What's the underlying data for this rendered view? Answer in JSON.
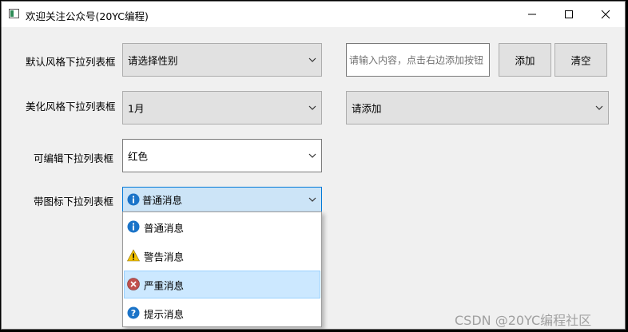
{
  "window": {
    "title": "欢迎关注公众号(20YC编程)"
  },
  "row1": {
    "label": "默认风格下拉列表框",
    "combo_value": "请选择性别",
    "input_placeholder": "请输入内容，点击右边添加按钮",
    "add_button": "添加",
    "clear_button": "清空"
  },
  "row2": {
    "label": "美化风格下拉列表框",
    "combo_value": "1月",
    "combo2_value": "请添加"
  },
  "row3": {
    "label": "可编辑下拉列表框",
    "combo_value": "红色"
  },
  "row4": {
    "label": "带图标下拉列表框",
    "combo_value": "普通消息",
    "combo_icon": "info-icon",
    "options": [
      {
        "label": "普通消息",
        "icon": "info-icon"
      },
      {
        "label": "警告消息",
        "icon": "warning-icon"
      },
      {
        "label": "严重消息",
        "icon": "error-icon",
        "selected": true
      },
      {
        "label": "提示消息",
        "icon": "question-icon"
      }
    ]
  },
  "watermark": "CSDN @20YC编程社区",
  "colors": {
    "info": "#1a73c8",
    "warning": "#f5c400",
    "error": "#c0504d",
    "question": "#1a73c8",
    "focus_border": "#0078d7"
  }
}
